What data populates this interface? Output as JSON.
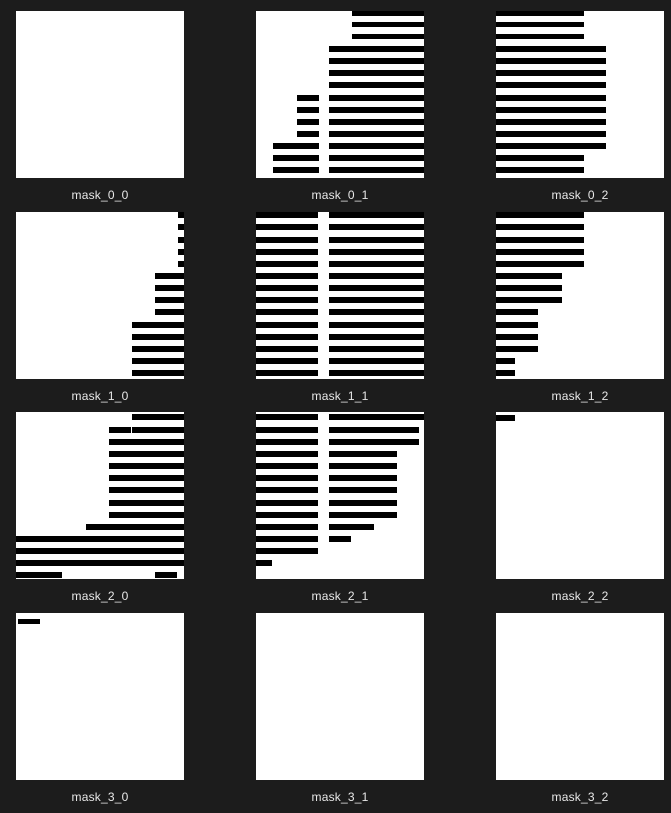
{
  "window": {
    "background": "#1c1c1c"
  },
  "tiles": [
    {
      "id": "mask_0_0",
      "label": "mask_0_0"
    },
    {
      "id": "mask_0_1",
      "label": "mask_0_1"
    },
    {
      "id": "mask_0_2",
      "label": "mask_0_2"
    },
    {
      "id": "mask_1_0",
      "label": "mask_1_0"
    },
    {
      "id": "mask_1_1",
      "label": "mask_1_1"
    },
    {
      "id": "mask_1_2",
      "label": "mask_1_2"
    },
    {
      "id": "mask_2_0",
      "label": "mask_2_0"
    },
    {
      "id": "mask_2_1",
      "label": "mask_2_1"
    },
    {
      "id": "mask_2_2",
      "label": "mask_2_2"
    },
    {
      "id": "mask_3_0",
      "label": "mask_3_0"
    },
    {
      "id": "mask_3_1",
      "label": "mask_3_1"
    },
    {
      "id": "mask_3_2",
      "label": "mask_3_2"
    }
  ],
  "colors": {
    "mask_foreground": "#000000",
    "mask_background": "#ffffff",
    "caption_text": "#e8e8e8"
  }
}
